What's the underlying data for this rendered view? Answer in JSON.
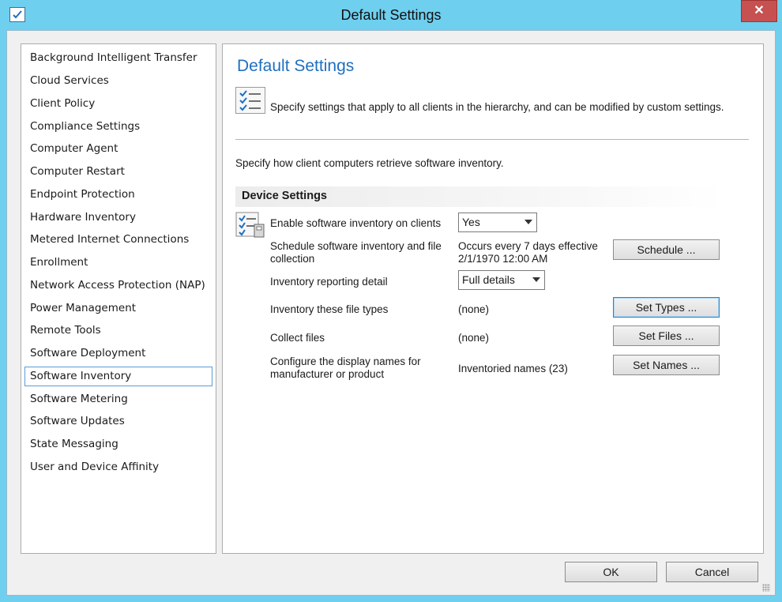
{
  "window": {
    "title": "Default Settings"
  },
  "sidebar": {
    "items": [
      {
        "label": "Background Intelligent Transfer"
      },
      {
        "label": "Cloud Services"
      },
      {
        "label": "Client Policy"
      },
      {
        "label": "Compliance Settings"
      },
      {
        "label": "Computer Agent"
      },
      {
        "label": "Computer Restart"
      },
      {
        "label": "Endpoint Protection"
      },
      {
        "label": "Hardware Inventory"
      },
      {
        "label": "Metered Internet Connections"
      },
      {
        "label": "Enrollment"
      },
      {
        "label": "Network Access Protection (NAP)"
      },
      {
        "label": "Power Management"
      },
      {
        "label": "Remote Tools"
      },
      {
        "label": "Software Deployment"
      },
      {
        "label": "Software Inventory",
        "selected": true
      },
      {
        "label": "Software Metering"
      },
      {
        "label": "Software Updates"
      },
      {
        "label": "State Messaging"
      },
      {
        "label": "User and Device Affinity"
      }
    ]
  },
  "main": {
    "title": "Default Settings",
    "header_description": "Specify settings that apply to all clients in the hierarchy, and can be modified by custom settings.",
    "intro": "Specify how client computers retrieve software inventory.",
    "section_title": "Device Settings",
    "settings": {
      "enable_label": "Enable software inventory on clients",
      "enable_value": "Yes",
      "schedule_label_1": "Schedule software inventory and file",
      "schedule_label_2": "collection",
      "schedule_value_1": "Occurs every 7 days effective",
      "schedule_value_2": "2/1/1970 12:00 AM",
      "schedule_button": "Schedule ...",
      "reporting_label": "Inventory reporting detail",
      "reporting_value": "Full details",
      "file_types_label": "Inventory these file types",
      "file_types_value": "(none)",
      "file_types_button": "Set Types ...",
      "collect_label": "Collect files",
      "collect_value": "(none)",
      "collect_button": "Set Files ...",
      "names_label_1": "Configure the display names for",
      "names_label_2": "manufacturer or product",
      "names_value": "Inventoried names (23)",
      "names_button": "Set Names ..."
    }
  },
  "footer": {
    "ok": "OK",
    "cancel": "Cancel"
  },
  "colors": {
    "titlebar": "#6fcfef",
    "title_accent": "#1e6fc0",
    "close": "#c75050"
  }
}
